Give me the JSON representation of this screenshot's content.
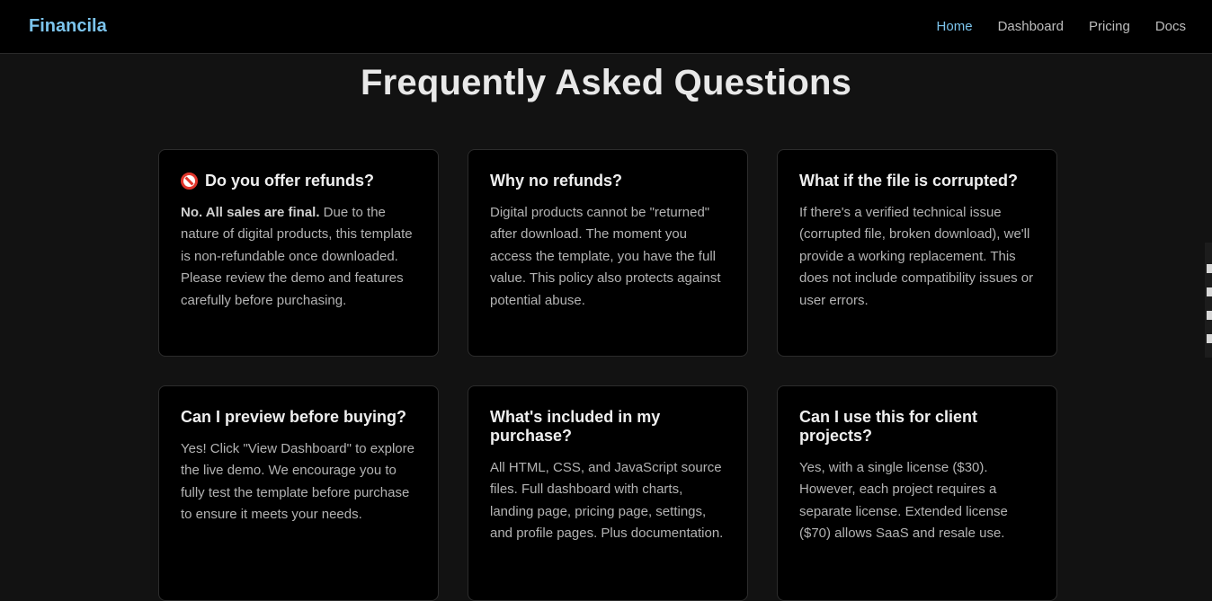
{
  "nav": {
    "brand": "Financila",
    "links": [
      {
        "label": "Home",
        "active": true
      },
      {
        "label": "Dashboard",
        "active": false
      },
      {
        "label": "Pricing",
        "active": false
      },
      {
        "label": "Docs",
        "active": false
      }
    ]
  },
  "faq": {
    "title": "Frequently Asked Questions",
    "items": [
      {
        "icon": "no-entry-icon",
        "question": "Do you offer refunds?",
        "answer_strong": "No. All sales are final.",
        "answer": " Due to the nature of digital products, this template is non-refundable once downloaded. Please review the demo and features carefully before purchasing."
      },
      {
        "question": "Why no refunds?",
        "answer": "Digital products cannot be \"returned\" after download. The moment you access the template, you have the full value. This policy also protects against potential abuse."
      },
      {
        "question": "What if the file is corrupted?",
        "answer": "If there's a verified technical issue (corrupted file, broken download), we'll provide a working replacement. This does not include compatibility issues or user errors."
      },
      {
        "question": "Can I preview before buying?",
        "answer": "Yes! Click \"View Dashboard\" to explore the live demo. We encourage you to fully test the template before purchase to ensure it meets your needs."
      },
      {
        "question": "What's included in my purchase?",
        "answer": "All HTML, CSS, and JavaScript source files. Full dashboard with charts, landing page, pricing page, settings, and profile pages. Plus documentation."
      },
      {
        "question": "Can I use this for client projects?",
        "answer": "Yes, with a single license ($30). However, each project requires a separate license. Extended license ($70) allows SaaS and resale use."
      }
    ]
  },
  "colors": {
    "accent": "#7cc4ec",
    "background": "#121212",
    "card": "#000000"
  }
}
